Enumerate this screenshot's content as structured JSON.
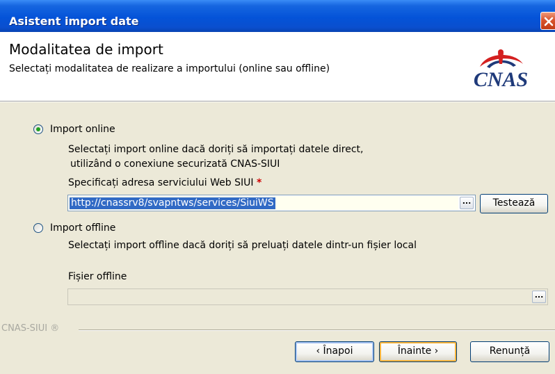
{
  "window": {
    "title": "Asistent import date",
    "close_icon": "close-icon"
  },
  "header": {
    "title": "Modalitatea de import",
    "subtitle": "Selectați modalitatea de realizare a importului (online sau offline)",
    "logo_text": "CNAS"
  },
  "online": {
    "label": "Import online",
    "selected": true,
    "description_line1": "Selectați import online dacă doriți să importați datele direct,",
    "description_line2": "utilizând o conexiune securizată CNAS-SIUI",
    "address_label": "Specificați adresa serviciului Web SIUI",
    "required_marker": "*",
    "address_value": "http://cnassrv8/svapntws/services/SiuiWS",
    "browse_label": "...",
    "test_button": "Testează"
  },
  "offline": {
    "label": "Import offline",
    "selected": false,
    "description": "Selectați import offline dacă doriți să preluați datele dintr-un fișier local",
    "file_label": "Fișier offline",
    "file_value": "",
    "browse_label": "..."
  },
  "footer": {
    "brand": "CNAS-SIUI ®",
    "back_button": "‹ Înapoi",
    "next_button": "Înainte ›",
    "cancel_button": "Renunță"
  },
  "colors": {
    "titlebar": "#0453d8",
    "dialog_bg": "#ece9d8",
    "selection": "#316ac5",
    "required": "#d00000",
    "logo_red": "#d42020",
    "logo_blue": "#1f3a7a"
  }
}
